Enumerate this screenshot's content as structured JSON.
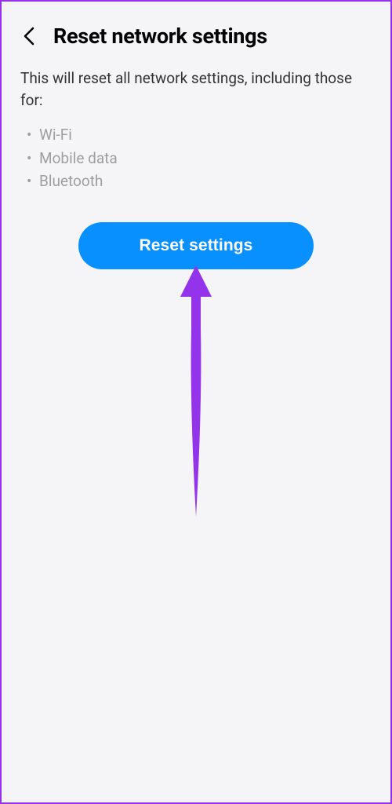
{
  "header": {
    "title": "Reset network settings"
  },
  "description": "This will reset all network settings, including those for:",
  "bullets": {
    "item0": "Wi-Fi",
    "item1": "Mobile data",
    "item2": "Bluetooth"
  },
  "button": {
    "reset_label": "Reset settings"
  },
  "colors": {
    "accent": "#0990ff",
    "annotation": "#9333ea"
  }
}
